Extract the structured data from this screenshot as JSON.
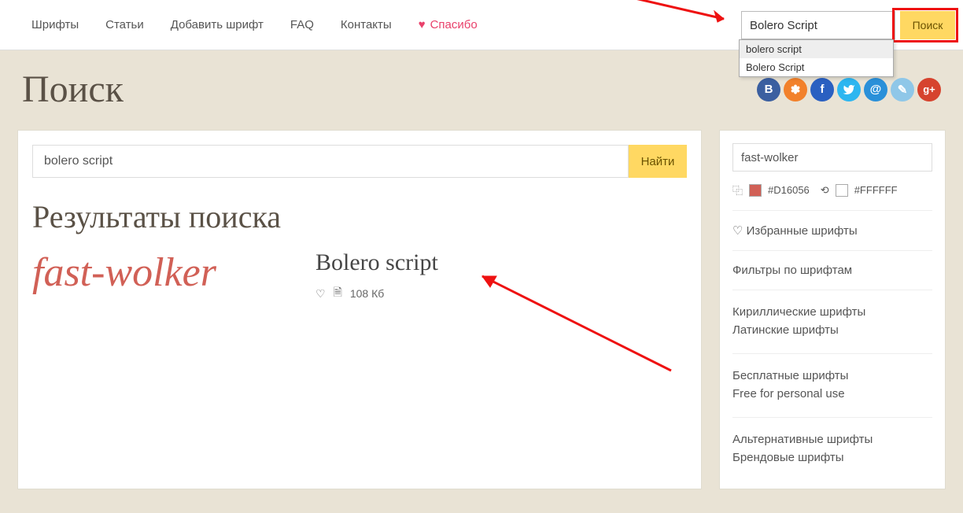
{
  "nav": {
    "items": [
      "Шрифты",
      "Статьи",
      "Добавить шрифт",
      "FAQ",
      "Контакты"
    ],
    "thanks": "Спасибо"
  },
  "topsearch": {
    "value": "Bolero Script",
    "button": "Поиск",
    "suggestions": [
      "bolero script",
      "Bolero Script"
    ]
  },
  "page_title": "Поиск",
  "social_icons": [
    "vk",
    "ok",
    "fb",
    "tw",
    "ml",
    "lj",
    "gp"
  ],
  "main": {
    "search_value": "bolero script",
    "find_button": "Найти",
    "results_heading": "Результаты поиска",
    "result": {
      "preview_text": "fast-wolker",
      "name": "Bolero script",
      "size": "108 Кб"
    }
  },
  "sidebar": {
    "preview_value": "fast-wolker",
    "color1": "#D16056",
    "color2": "#FFFFFF",
    "favorites": "Избранные шрифты",
    "filters": "Фильтры по шрифтам",
    "group_enc": [
      "Кириллические шрифты",
      "Латинские шрифты"
    ],
    "group_lic": [
      "Бесплатные шрифты",
      "Free for personal use"
    ],
    "group_cat": [
      "Альтернативные шрифты",
      "Брендовые шрифты"
    ]
  }
}
